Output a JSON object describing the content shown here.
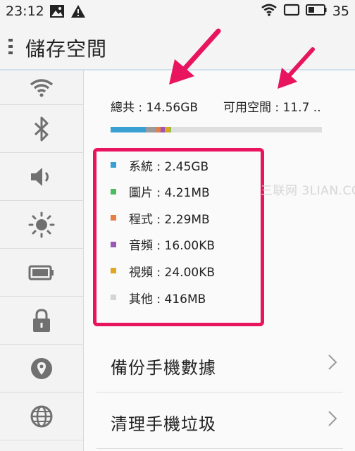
{
  "status_bar": {
    "time": "23:12",
    "battery_level": "35",
    "icons": [
      "image-icon",
      "warning-icon",
      "wifi-icon",
      "screen-rotation-icon",
      "battery-icon"
    ]
  },
  "header": {
    "title": "儲存空間"
  },
  "sidebar": {
    "items": [
      {
        "icon": "wifi-icon"
      },
      {
        "icon": "bluetooth-icon"
      },
      {
        "icon": "volume-icon"
      },
      {
        "icon": "brightness-icon"
      },
      {
        "icon": "battery-icon"
      },
      {
        "icon": "lock-icon"
      },
      {
        "icon": "location-icon"
      },
      {
        "icon": "globe-icon"
      }
    ]
  },
  "storage": {
    "total": "總共 : 14.56GB",
    "available": "可用空間 : 11.7 ..",
    "bar": [
      {
        "color": "#3a9fd3",
        "fraction": 0.168
      },
      {
        "color": "#9b9b9b",
        "fraction": 0.05
      },
      {
        "color": "#e67e45",
        "fraction": 0.02
      },
      {
        "color": "#9b59b6",
        "fraction": 0.02
      },
      {
        "color": "#e1a623",
        "fraction": 0.02
      },
      {
        "color": "#8bc34a",
        "fraction": 0.01
      }
    ]
  },
  "legend": [
    {
      "label": "系統 : 2.45GB",
      "color": "#3a9fd3"
    },
    {
      "label": "圖片 : 4.21MB",
      "color": "#4dbb5f"
    },
    {
      "label": "程式 : 2.29MB",
      "color": "#e67e45"
    },
    {
      "label": "音頻 : 16.00KB",
      "color": "#9b59b6"
    },
    {
      "label": "視頻 : 24.00KB",
      "color": "#e1a623"
    },
    {
      "label": "其他 : 416MB",
      "color": "#d5d5d5"
    }
  ],
  "actions": {
    "backup_label": "備份手機數據",
    "cleanup_label": "清理手機垃圾"
  },
  "watermark": "三联网 3LIAN.COM",
  "colors": {
    "highlight": "#e8145d",
    "accent_line": "#cfe1ea"
  }
}
